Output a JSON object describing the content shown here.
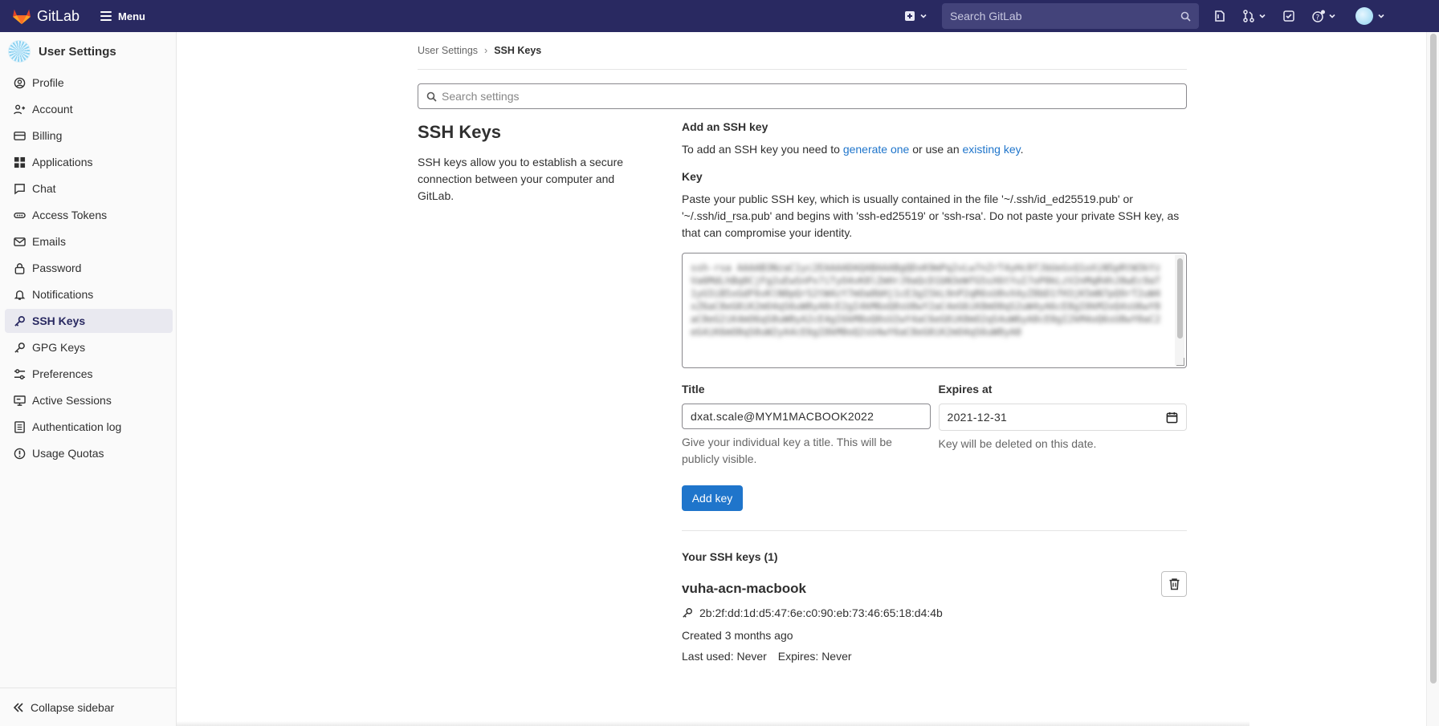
{
  "topbar": {
    "brand": "GitLab",
    "menu_label": "Menu",
    "search_placeholder": "Search GitLab",
    "colors": {
      "background": "#292961"
    }
  },
  "sidebar": {
    "title": "User Settings",
    "items": [
      {
        "label": "Profile",
        "icon": "profile-icon"
      },
      {
        "label": "Account",
        "icon": "account-icon"
      },
      {
        "label": "Billing",
        "icon": "billing-icon"
      },
      {
        "label": "Applications",
        "icon": "applications-icon"
      },
      {
        "label": "Chat",
        "icon": "chat-icon"
      },
      {
        "label": "Access Tokens",
        "icon": "token-icon"
      },
      {
        "label": "Emails",
        "icon": "mail-icon"
      },
      {
        "label": "Password",
        "icon": "lock-icon"
      },
      {
        "label": "Notifications",
        "icon": "bell-icon"
      },
      {
        "label": "SSH Keys",
        "icon": "key-icon",
        "active": true
      },
      {
        "label": "GPG Keys",
        "icon": "key-icon"
      },
      {
        "label": "Preferences",
        "icon": "preferences-icon"
      },
      {
        "label": "Active Sessions",
        "icon": "monitor-icon"
      },
      {
        "label": "Authentication log",
        "icon": "log-icon"
      },
      {
        "label": "Usage Quotas",
        "icon": "quota-icon"
      }
    ],
    "collapse_label": "Collapse sidebar"
  },
  "breadcrumb": {
    "parent": "User Settings",
    "current": "SSH Keys"
  },
  "settings_search": {
    "placeholder": "Search settings"
  },
  "left": {
    "heading": "SSH Keys",
    "description": "SSH keys allow you to establish a secure connection between your computer and GitLab."
  },
  "form": {
    "section_title": "Add an SSH key",
    "intro_prefix": "To add an SSH key you need to",
    "generate_link": "generate one",
    "intro_mid": "or use an",
    "existing_link": "existing key",
    "intro_suffix": ".",
    "key_label": "Key",
    "key_help": "Paste your public SSH key, which is usually contained in the file '~/.ssh/id_ed25519.pub' or '~/.ssh/id_rsa.pub' and begins with 'ssh-ed25519' or 'ssh-rsa'. Do not paste your private SSH key, as that can compromise your identity.",
    "title_label": "Title",
    "title_value": "dxat.scale@MYM1MACBOOK2022",
    "title_hint": "Give your individual key a title. This will be publicly visible.",
    "expires_label": "Expires at",
    "expires_value": "2021-12-31",
    "expires_hint": "Key will be deleted on this date.",
    "submit_label": "Add key"
  },
  "keys": {
    "heading": "Your SSH keys (1)",
    "items": [
      {
        "name": "vuha-acn-macbook",
        "fingerprint": "2b:2f:dd:1d:d5:47:6e:c0:90:eb:73:46:65:18:d4:4b",
        "created": "Created 3 months ago",
        "last_used": "Last used: Never",
        "expires": "Expires: Never"
      }
    ]
  }
}
